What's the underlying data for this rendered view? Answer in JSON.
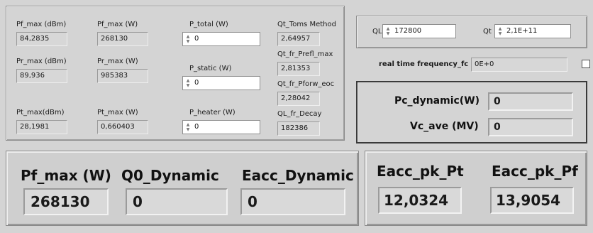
{
  "top_left": {
    "pf_max_dbm_label": "Pf_max (dBm)",
    "pf_max_dbm_value": "84,2835",
    "pf_max_w_label": "Pf_max (W)",
    "pf_max_w_value": "268130",
    "p_total_label": "P_total (W)",
    "p_total_value": "0",
    "qt_toms_label": "Qt_Toms Method",
    "qt_toms_value": "2,64957",
    "qt_prefl_label": "Qt_fr_Prefl_max",
    "qt_prefl_value": "2,81353",
    "pr_max_dbm_label": "Pr_max (dBm)",
    "pr_max_dbm_value": "89,936",
    "pr_max_w_label": "Pr_max (W)",
    "pr_max_w_value": "985383",
    "p_static_label": "P_static (W)",
    "p_static_value": "0",
    "qt_pforw_label": "Qt_fr_Pforw_eoc",
    "qt_pforw_value": "2,28042",
    "pt_max_dbm_label": "Pt_max(dBm)",
    "pt_max_dbm_value": "28,1981",
    "pt_max_w_label": "Pt_max (W)",
    "pt_max_w_value": "0,660403",
    "p_heater_label": "P_heater (W)",
    "p_heater_value": "0",
    "ql_decay_label": "QL_fr_Decay",
    "ql_decay_value": "182386"
  },
  "top_right": {
    "ql_label": "QL",
    "ql_value": "172800",
    "qt_label": "Qt",
    "qt_value": "2,1E+11",
    "fc_label": "real time frequency_fc",
    "fc_value": "0E+0",
    "pc_dynamic_label": "Pc_dynamic(W)",
    "pc_dynamic_value": "0",
    "vc_ave_label": "Vc_ave (MV)",
    "vc_ave_value": "0"
  },
  "bottom_left": {
    "pf_max_label": "Pf_max (W)",
    "pf_max_value": "268130",
    "q0_label": "Q0_Dynamic",
    "q0_value": "0",
    "eacc_label": "Eacc_Dynamic",
    "eacc_value": "0"
  },
  "bottom_right": {
    "eacc_pk_pt_label": "Eacc_pk_Pt",
    "eacc_pk_pt_value": "12,0324",
    "eacc_pk_pf_label": "Eacc_pk_Pf",
    "eacc_pk_pf_value": "13,9054"
  },
  "spin_icons": {
    "up": "▲",
    "down": "▼"
  }
}
